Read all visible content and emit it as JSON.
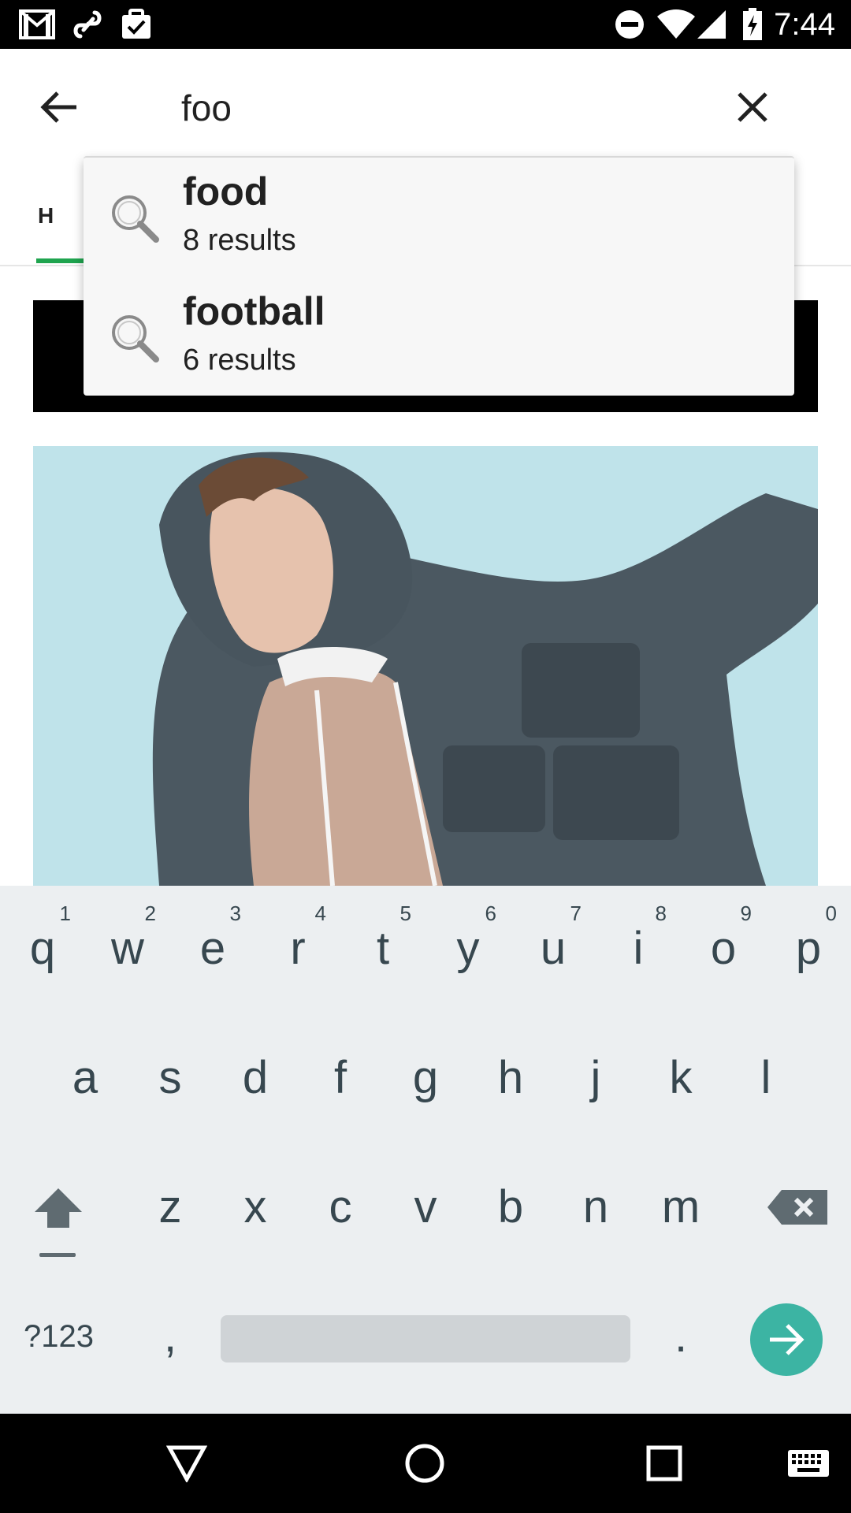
{
  "status_bar": {
    "time": "7:44",
    "left_icons": [
      "gmail-icon",
      "link-icon",
      "task-icon"
    ],
    "right_icons": [
      "dnd-icon",
      "wifi-icon",
      "signal-icon",
      "battery-charging-icon"
    ]
  },
  "app_bar": {
    "search_value": "foo",
    "back_icon": "arrow-back-icon",
    "clear_icon": "close-icon"
  },
  "tabs": {
    "first_tab_visible": "H"
  },
  "suggestions": [
    {
      "title": "food",
      "count": "8 results",
      "icon": "search-icon"
    },
    {
      "title": "football",
      "count": "6 results",
      "icon": "search-icon"
    }
  ],
  "keyboard": {
    "row1": [
      {
        "key": "q",
        "hint": "1"
      },
      {
        "key": "w",
        "hint": "2"
      },
      {
        "key": "e",
        "hint": "3"
      },
      {
        "key": "r",
        "hint": "4"
      },
      {
        "key": "t",
        "hint": "5"
      },
      {
        "key": "y",
        "hint": "6"
      },
      {
        "key": "u",
        "hint": "7"
      },
      {
        "key": "i",
        "hint": "8"
      },
      {
        "key": "o",
        "hint": "9"
      },
      {
        "key": "p",
        "hint": "0"
      }
    ],
    "row2": [
      "a",
      "s",
      "d",
      "f",
      "g",
      "h",
      "j",
      "k",
      "l"
    ],
    "row3": [
      "z",
      "x",
      "c",
      "v",
      "b",
      "n",
      "m"
    ],
    "symbols_label": "?123",
    "comma": ",",
    "period": "."
  },
  "colors": {
    "tab_indicator": "#1fa44f",
    "enter_button": "#3cb4a3",
    "keyboard_bg": "#eceff1",
    "hero_bg": "#bfe3ea"
  }
}
